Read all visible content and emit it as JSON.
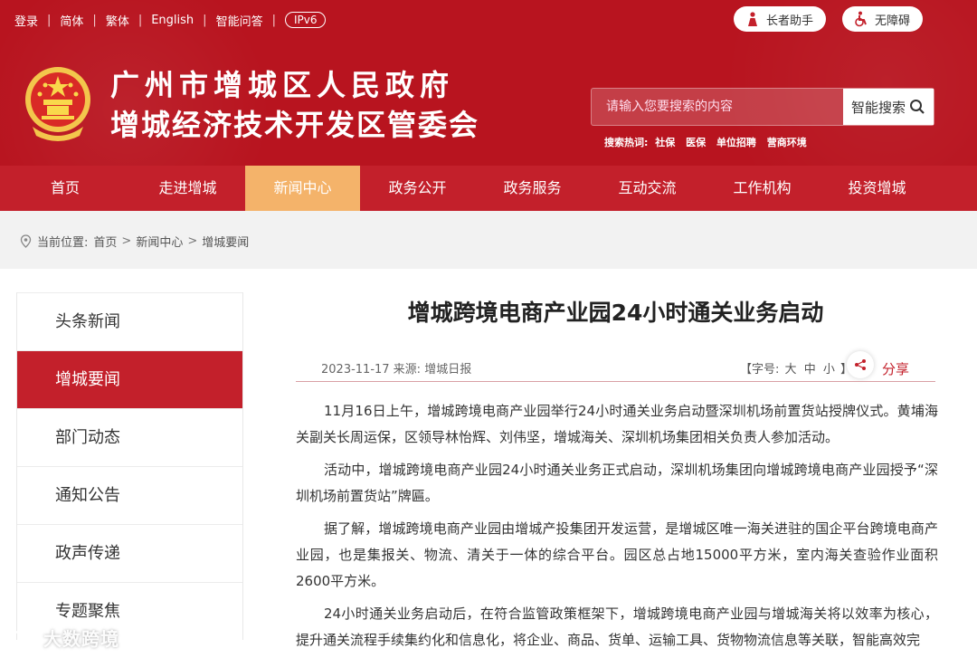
{
  "topbar": {
    "links": [
      "登录",
      "简体",
      "繁体",
      "English",
      "智能问答"
    ],
    "ipv6": "IPv6"
  },
  "elder_button": "长者助手",
  "accessibility_button": "无障碍",
  "site": {
    "title_line1": "广州市增城区人民政府",
    "title_line2": "增城经济技术开发区管委会"
  },
  "search": {
    "placeholder": "请输入您要搜索的内容",
    "button": "智能搜索",
    "hot_label": "搜索热词:",
    "hot_words": [
      "社保",
      "医保",
      "单位招聘",
      "营商环境"
    ]
  },
  "nav": [
    "首页",
    "走进增城",
    "新闻中心",
    "政务公开",
    "政务服务",
    "互动交流",
    "工作机构",
    "投资增城"
  ],
  "nav_active": "新闻中心",
  "breadcrumb": {
    "label": "当前位置:",
    "items": [
      "首页",
      "新闻中心",
      "增城要闻"
    ]
  },
  "sidebar": [
    "头条新闻",
    "增城要闻",
    "部门动态",
    "通知公告",
    "政声传递",
    "专题聚焦"
  ],
  "sidebar_active": "增城要闻",
  "article": {
    "title": "增城跨境电商产业园24小时通关业务启动",
    "meta": "2023-11-17 来源: 增城日报",
    "font_label": "【字号:",
    "font_sizes": [
      "大",
      "中",
      "小"
    ],
    "font_close": "】",
    "share": "分享",
    "paragraphs": [
      "11月16日上午，增城跨境电商产业园举行24小时通关业务启动暨深圳机场前置货站授牌仪式。黄埔海关副关长周运保，区领导林怡辉、刘伟坚，增城海关、深圳机场集团相关负责人参加活动。",
      "活动中，增城跨境电商产业园24小时通关业务正式启动，深圳机场集团向增城跨境电商产业园授予“深圳机场前置货站”牌匾。",
      "据了解，增城跨境电商产业园由增城产投集团开发运营，是增城区唯一海关进驻的国企平台跨境电商产业园，也是集报关、物流、清关于一体的综合平台。园区总占地15000平方米，室内海关查验作业面积2600平方米。",
      "24小时通关业务启动后，在符合监管政策框架下，增城跨境电商产业园与增城海关将以效率为核心，提升通关流程手续集约化和信息化，将企业、商品、货单、运输工具、货物物流信息等关联，智能高效完"
    ]
  },
  "watermark": "大数跨境",
  "colors": {
    "primary_red": "#b8141f",
    "nav_red": "#c3202b",
    "nav_active": "#f4b36a"
  }
}
